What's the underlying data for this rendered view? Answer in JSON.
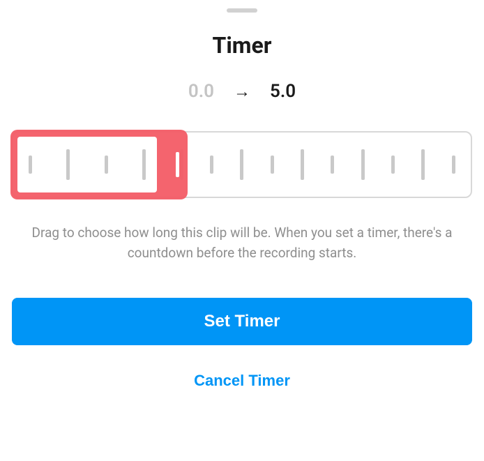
{
  "title": "Timer",
  "timeRange": {
    "start": "0.0",
    "end": "5.0"
  },
  "description": "Drag to choose how long this clip will be. When you set a timer, there's a countdown before the recording starts.",
  "buttons": {
    "primary": "Set Timer",
    "secondary": "Cancel Timer"
  }
}
